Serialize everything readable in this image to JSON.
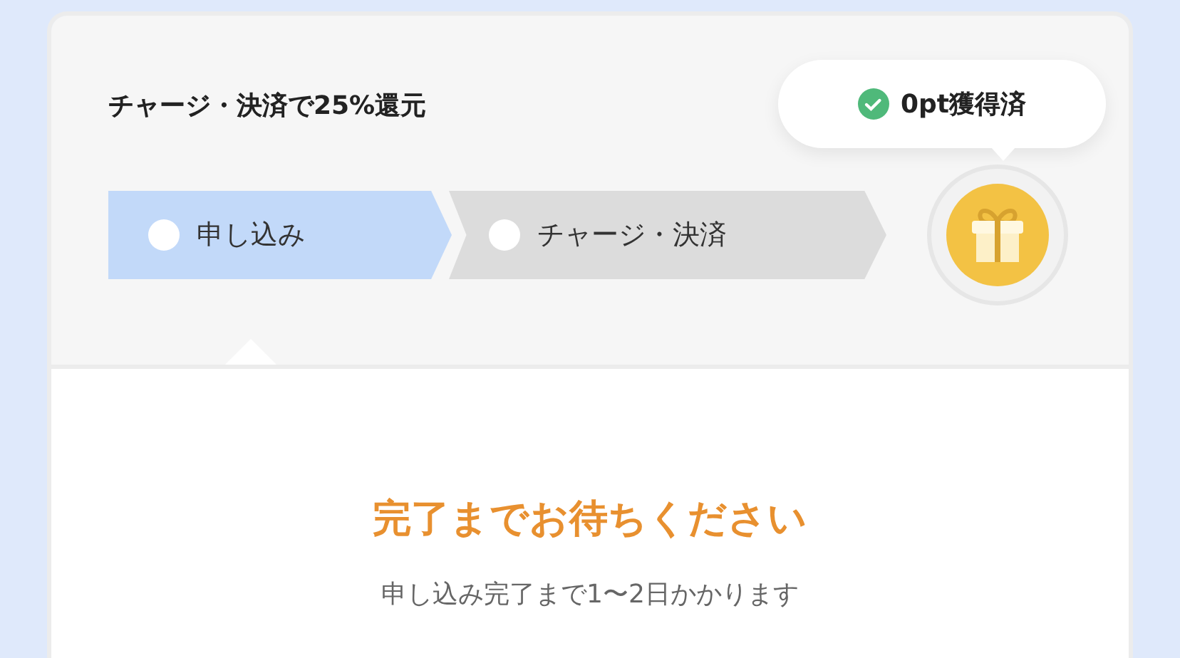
{
  "campaign": {
    "title": "チャージ・決済で25%還元",
    "points_badge": "0pt獲得済"
  },
  "steps": [
    {
      "label": "申し込み",
      "selected": true
    },
    {
      "label": "チャージ・決済",
      "selected": false
    }
  ],
  "status": {
    "heading": "完了までお待ちください",
    "message": "申し込み完了まで1〜2日かかります"
  }
}
